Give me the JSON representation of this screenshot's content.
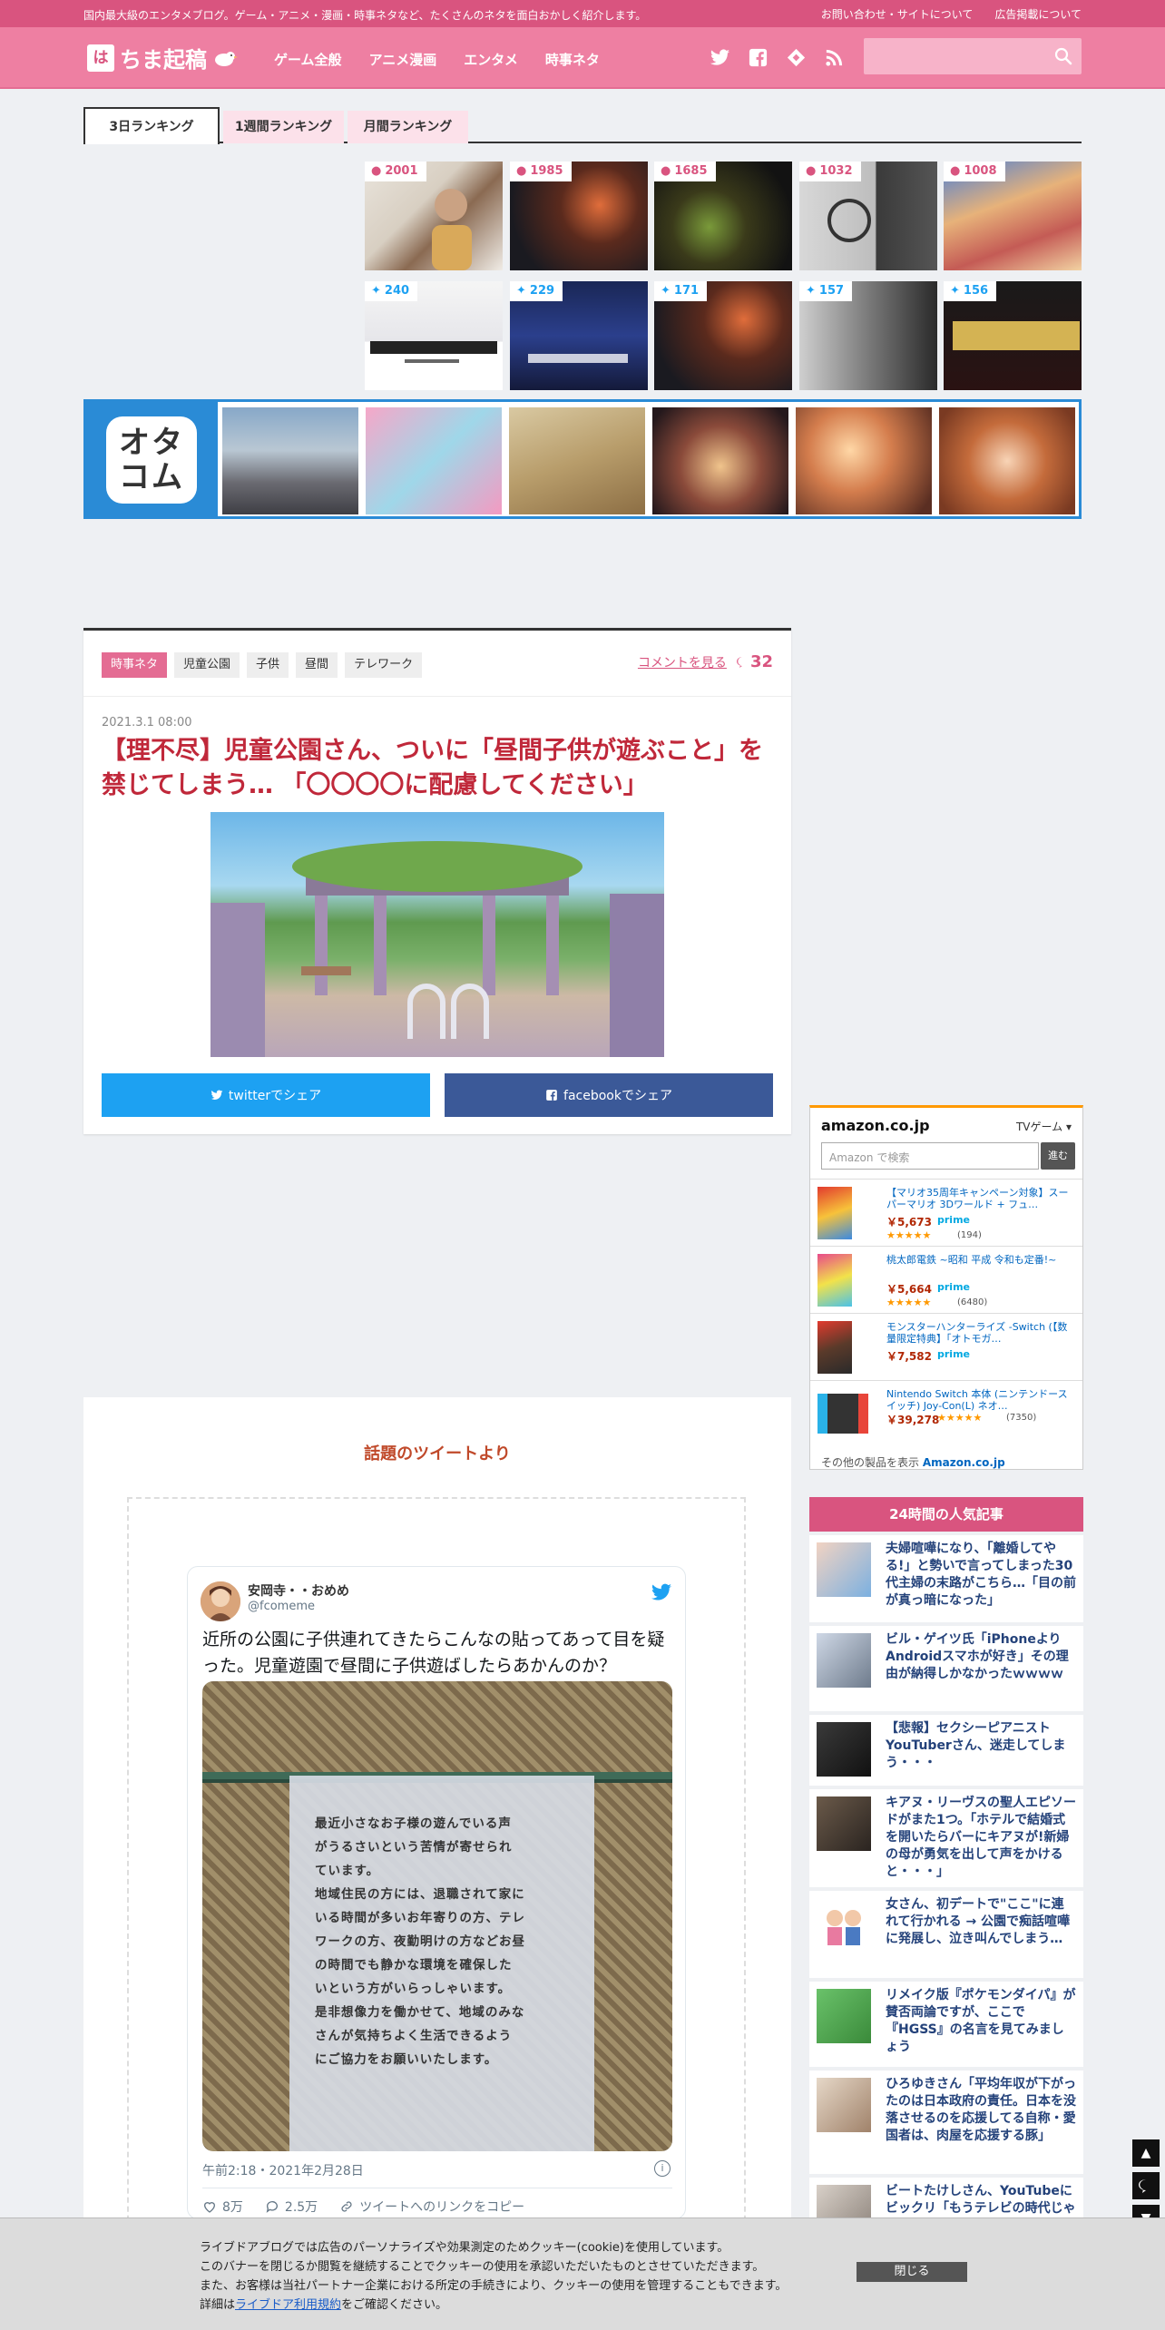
{
  "topbar": {
    "tagline": "国内最大級のエンタメブログ。ゲーム・アニメ・漫画・時事ネタなど、たくさんのネタを面白おかしく紹介します。",
    "links": [
      "お問い合わせ・サイトについて",
      "広告掲載について"
    ]
  },
  "header": {
    "logo_mark": "は",
    "logo_text": "ちま起稿",
    "nav": [
      "ゲーム全般",
      "アニメ漫画",
      "エンタメ",
      "時事ネタ"
    ]
  },
  "ranking": {
    "tabs": [
      "3日ランキング",
      "1週間ランキング",
      "月間ランキング"
    ],
    "comment_counts": [
      "2001",
      "1985",
      "1685",
      "1032",
      "1008"
    ],
    "tweet_counts": [
      "240",
      "229",
      "171",
      "157",
      "156"
    ]
  },
  "otacom": {
    "logo_text": "オタコム"
  },
  "article": {
    "tags": [
      "時事ネタ",
      "児童公園",
      "子供",
      "昼間",
      "テレワーク"
    ],
    "comment_link": "コメントを見る",
    "comment_count": "32",
    "date": "2021.3.1 08:00",
    "title": "【理不尽】児童公園さん、ついに「昼間子供が遊ぶこと」を禁じてしまう… 「〇〇〇〇に配慮してください」",
    "share_twitter": "twitterでシェア",
    "share_facebook": "facebookでシェア"
  },
  "tweets_section": {
    "heading": "話題のツイートより",
    "tweet": {
      "name": "安岡寺・・おめめ",
      "handle": "@fcomeme",
      "text": "近所の公園に子供連れてきたらこんなの貼ってあって目を疑った。児童遊園で昼間に子供遊ばしたらあかんのか？",
      "notice_lines": [
        "最近小さなお子様の遊んでいる声",
        "がうるさいという苦情が寄せられ",
        "ています。",
        "地域住民の方には、退職されて家に",
        "いる時間が多いお年寄りの方、テレ",
        "ワークの方、夜勤明けの方などお昼",
        "の時間でも静かな環境を確保した",
        "いという方がいらっしゃいます。",
        "是非想像力を働かせて、地域のみな",
        "さんが気持ちよく生活できるよう",
        "にご協力をお願いいたします。"
      ],
      "time": "午前2:18・2021年2月28日",
      "likes": "8万",
      "replies": "2.5万",
      "copy_link": "ツイートへのリンクをコピー"
    }
  },
  "amazon": {
    "brand": "amazon.co.jp",
    "category": "TVゲーム",
    "search_placeholder": "Amazon で検索",
    "search_button": "進む",
    "items": [
      {
        "title": "【マリオ35周年キャンペーン対象】スーパーマリオ 3Dワールド + フュ…",
        "price": "￥5,673",
        "prime": "prime",
        "stars": "★★★★★",
        "reviews": "(194)"
      },
      {
        "title": "桃太郎電鉄 ~昭和 平成 令和も定番!~",
        "price": "￥5,664",
        "prime": "prime",
        "stars": "★★★★★",
        "reviews": "(6480)"
      },
      {
        "title": "モンスターハンターライズ -Switch (【数量限定特典】「オトモガ…",
        "price": "￥7,582",
        "prime": "prime",
        "stars": "",
        "reviews": ""
      },
      {
        "title": "Nintendo Switch 本体 (ニンテンドースイッチ) Joy-Con(L) ネオ…",
        "price": "￥39,278",
        "prime": "",
        "stars": "★★★★★",
        "reviews": "(7350)"
      }
    ],
    "more_prefix": "その他の製品を表示",
    "more_link": "Amazon.co.jp"
  },
  "popular": {
    "heading": "24時間の人気記事",
    "items": [
      "夫婦喧嘩になり、「離婚してやる!」と勢いで言ってしまった30代主婦の末路がこちら…「目の前が真っ暗になった」",
      "ビル・ゲイツ氏「iPhoneよりAndroidスマホが好き」その理由が納得しかなかったｗｗｗｗ",
      "【悲報】セクシーピアニストYouTuberさん、迷走してしまう・・・",
      "キアヌ・リーヴスの聖人エピソードがまた1つ。「ホテルで結婚式を開いたらバーにキアヌが!新婦の母が勇気を出して声をかけると・・・」",
      "女さん、初デートで\"ここ\"に連れて行かれる → 公園で痴話喧嘩に発展し、泣き叫んでしまう…",
      "リメイク版『ポケモンダイパ』が賛否両論ですが、ここで『HGSS』の名言を見てみましょう",
      "ひろゆきさん「平均年収が下がったのは日本政府の責任。日本を没落させるのを応援してる自称・愛国者は、肉屋を応援する豚」",
      "ビートたけしさん、YouTubeにビックリ「もうテレビの時代じゃないな」"
    ]
  },
  "cookie": {
    "lines": [
      "ライブドアブログでは広告のパーソナライズや効果測定のためクッキー(cookie)を使用しています。",
      "このバナーを閉じるか閲覧を継続することでクッキーの使用を承認いただいたものとさせていただきます。",
      "また、お客様は当社パートナー企業における所定の手続きにより、クッキーの使用を管理することもできます。"
    ],
    "last_prefix": "詳細は",
    "last_link": "ライブドア利用規約",
    "last_suffix": "をご確認ください。",
    "close": "閉じる"
  }
}
